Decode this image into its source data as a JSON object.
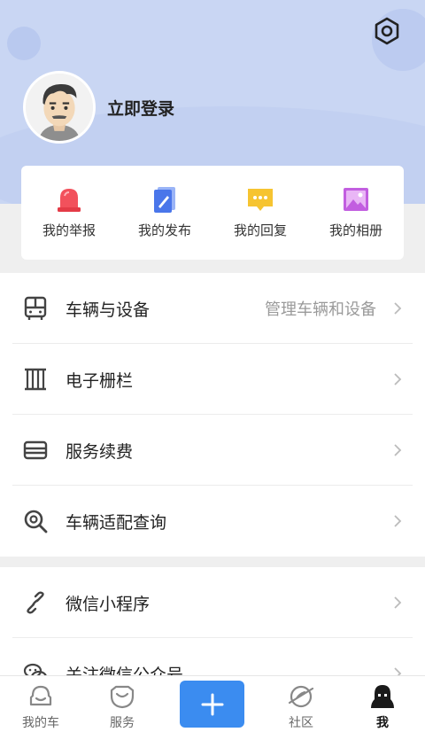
{
  "header": {
    "login_text": "立即登录"
  },
  "quick": [
    {
      "label": "我的举报",
      "icon": "siren-icon"
    },
    {
      "label": "我的发布",
      "icon": "publish-icon"
    },
    {
      "label": "我的回复",
      "icon": "reply-icon"
    },
    {
      "label": "我的相册",
      "icon": "album-icon"
    }
  ],
  "menu1": [
    {
      "label": "车辆与设备",
      "sub": "管理车辆和设备",
      "icon": "bus-icon"
    },
    {
      "label": "电子栅栏",
      "icon": "fence-icon"
    },
    {
      "label": "服务续费",
      "icon": "card-icon"
    },
    {
      "label": "车辆适配查询",
      "icon": "search-icon"
    }
  ],
  "menu2": [
    {
      "label": "微信小程序",
      "icon": "link-icon"
    },
    {
      "label": "关注微信公众号",
      "icon": "wechat-icon"
    }
  ],
  "tabs": [
    {
      "label": "我的车",
      "icon": "car-icon"
    },
    {
      "label": "服务",
      "icon": "service-icon"
    },
    {
      "label": "社区",
      "icon": "community-icon"
    },
    {
      "label": "我",
      "icon": "me-icon"
    }
  ],
  "colors": {
    "accent": "#3b8cf0",
    "header_bg": "#c9d6f3"
  }
}
